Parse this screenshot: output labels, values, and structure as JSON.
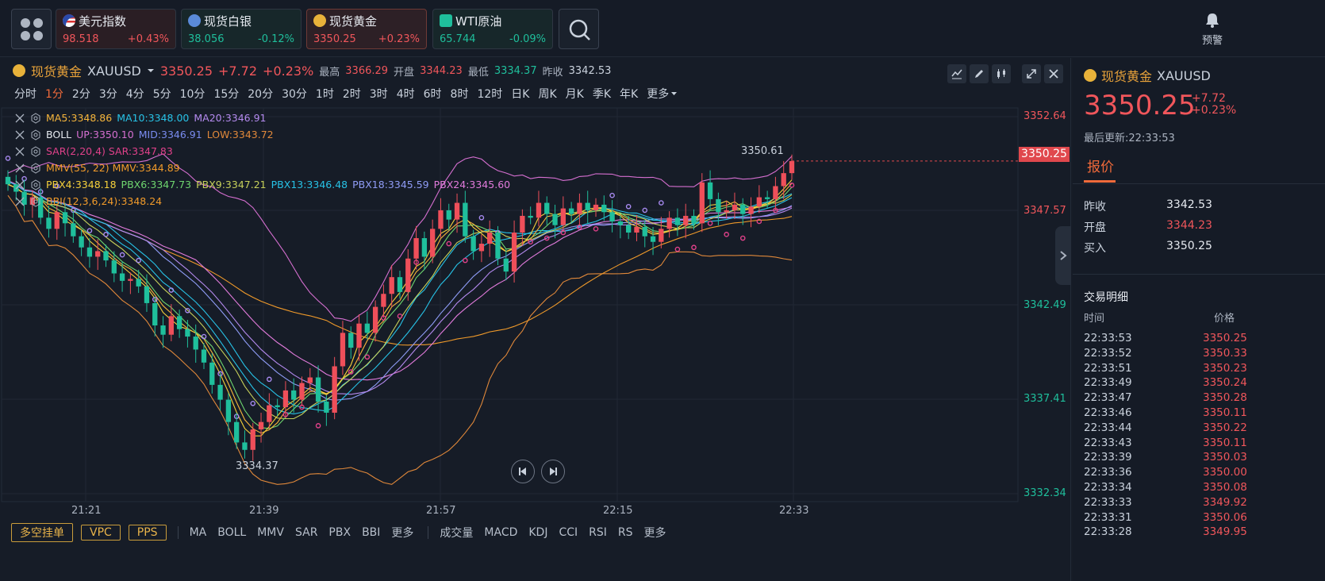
{
  "topbar": {
    "tickers": [
      {
        "name": "美元指数",
        "price": "98.518",
        "change": "+0.43%",
        "trend": "up",
        "icon": "us-flag-icon"
      },
      {
        "name": "现货白银",
        "price": "38.056",
        "change": "-0.12%",
        "trend": "down",
        "icon": "silver-icon"
      },
      {
        "name": "现货黄金",
        "price": "3350.25",
        "change": "+0.23%",
        "trend": "up",
        "icon": "gold-icon"
      },
      {
        "name": "WTI原油",
        "price": "65.744",
        "change": "-0.09%",
        "trend": "down",
        "icon": "oil-icon"
      }
    ],
    "alarm_label": "预警"
  },
  "chart_header": {
    "name": "现货黄金",
    "symbol": "XAUUSD",
    "price": "3350.25",
    "change": "+7.72",
    "change_pct": "+0.23%",
    "high_label": "最高",
    "high": "3366.29",
    "open_label": "开盘",
    "open": "3344.23",
    "low_label": "最低",
    "low": "3334.37",
    "prev_label": "昨收",
    "prev": "3342.53"
  },
  "periods": [
    "分时",
    "1分",
    "2分",
    "3分",
    "4分",
    "5分",
    "10分",
    "15分",
    "20分",
    "30分",
    "1时",
    "2时",
    "3时",
    "4时",
    "6时",
    "8时",
    "12时",
    "日K",
    "周K",
    "月K",
    "季K",
    "年K",
    "更多"
  ],
  "active_period": "1分",
  "indicators": [
    {
      "items": [
        {
          "text": "MA5:3348.86",
          "color": "#f6b53b"
        },
        {
          "text": "MA10:3348.00",
          "color": "#27c2e6"
        },
        {
          "text": "MA20:3346.91",
          "color": "#b48aef"
        }
      ]
    },
    {
      "items": [
        {
          "text": "BOLL",
          "color": "#e6eaf0"
        },
        {
          "text": "UP:3350.10",
          "color": "#d56fd0"
        },
        {
          "text": "MID:3346.91",
          "color": "#7a8cf0"
        },
        {
          "text": "LOW:3343.72",
          "color": "#e0883a"
        }
      ]
    },
    {
      "items": [
        {
          "text": "SAR(2,20,4) SAR:3347.83",
          "color": "#e0418a"
        }
      ]
    },
    {
      "items": [
        {
          "text": "MMV(55, 22) MMV:3344.89",
          "color": "#f09a2a"
        }
      ]
    },
    {
      "items": [
        {
          "text": "PBX4:3348.18",
          "color": "#f6d13b"
        },
        {
          "text": "PBX6:3347.73",
          "color": "#6fd66f"
        },
        {
          "text": "PBX9:3347.21",
          "color": "#c6d05a"
        },
        {
          "text": "PBX13:3346.48",
          "color": "#27c2e6"
        },
        {
          "text": "PBX18:3345.59",
          "color": "#8f9cf6"
        },
        {
          "text": "PBX24:3345.60",
          "color": "#e27bdc"
        }
      ]
    },
    {
      "items": [
        {
          "text": "BBI(12,3,6,24):3348.24",
          "color": "#f09a2a"
        }
      ]
    }
  ],
  "chart_data": {
    "type": "candlestick",
    "y_axis": {
      "ticks": [
        "3352.64",
        "3347.57",
        "3342.49",
        "3337.41",
        "3332.34"
      ],
      "min": 3332.34,
      "max": 3352.64
    },
    "x_axis": {
      "ticks": [
        "21:21",
        "21:39",
        "21:57",
        "22:15",
        "22:33"
      ]
    },
    "current_price": "3350.25",
    "annotations": {
      "high_mark": "3350.61",
      "low_mark": "3334.37"
    },
    "close": [
      3349.0,
      3348.6,
      3347.9,
      3348.3,
      3347.2,
      3346.6,
      3347.5,
      3346.9,
      3346.2,
      3345.6,
      3345.1,
      3345.4,
      3344.9,
      3344.2,
      3343.8,
      3343.9,
      3343.5,
      3342.6,
      3341.4,
      3340.9,
      3341.9,
      3341.2,
      3340.8,
      3340.1,
      3339.4,
      3338.2,
      3337.4,
      3336.2,
      3335.1,
      3334.7,
      3335.8,
      3336.2,
      3337.1,
      3337.0,
      3337.9,
      3337.4,
      3338.3,
      3338.6,
      3337.3,
      3336.7,
      3339.2,
      3341.0,
      3340.2,
      3341.5,
      3341.0,
      3342.4,
      3343.1,
      3344.0,
      3343.2,
      3345.0,
      3346.1,
      3345.1,
      3346.6,
      3347.6,
      3347.1,
      3348.0,
      3346.2,
      3345.4,
      3345.8,
      3346.4,
      3345.0,
      3344.3,
      3346.4,
      3347.3,
      3347.2,
      3348.0,
      3347.4,
      3346.8,
      3347.7,
      3347.4,
      3348.0,
      3347.6,
      3347.9,
      3347.5,
      3347.0,
      3346.8,
      3346.4,
      3346.7,
      3346.2,
      3345.9,
      3346.6,
      3347.2,
      3346.8,
      3347.3,
      3346.9,
      3349.1,
      3348.2,
      3347.5,
      3347.6,
      3347.9,
      3347.4,
      3347.8,
      3348.3,
      3348.2,
      3348.9,
      3349.6,
      3350.25
    ]
  },
  "bottombar": {
    "buttons": [
      "多空挂单",
      "VPC",
      "PPS"
    ],
    "main_indicators": [
      "MA",
      "BOLL",
      "MMV",
      "SAR",
      "PBX",
      "BBI",
      "更多"
    ],
    "sub_indicators": [
      "成交量",
      "MACD",
      "KDJ",
      "CCI",
      "RSI",
      "RS",
      "更多"
    ]
  },
  "right_panel": {
    "name": "现货黄金",
    "symbol": "XAUUSD",
    "price": "3350.25",
    "change": "+7.72",
    "change_pct": "+0.23%",
    "updated": "最后更新:22:33:53",
    "tab": "报价",
    "quotes": [
      {
        "label": "昨收",
        "value": "3342.53",
        "trend": "neutral"
      },
      {
        "label": "开盘",
        "value": "3344.23",
        "trend": "up"
      },
      {
        "label": "买入",
        "value": "3350.25",
        "trend": "neutral"
      }
    ],
    "trades_title": "交易明细",
    "col_time": "时间",
    "col_price": "价格",
    "trades": [
      {
        "time": "22:33:53",
        "price": "3350.25"
      },
      {
        "time": "22:33:52",
        "price": "3350.33"
      },
      {
        "time": "22:33:51",
        "price": "3350.23"
      },
      {
        "time": "22:33:49",
        "price": "3350.24"
      },
      {
        "time": "22:33:47",
        "price": "3350.28"
      },
      {
        "time": "22:33:46",
        "price": "3350.11"
      },
      {
        "time": "22:33:44",
        "price": "3350.22"
      },
      {
        "time": "22:33:43",
        "price": "3350.11"
      },
      {
        "time": "22:33:39",
        "price": "3350.03"
      },
      {
        "time": "22:33:36",
        "price": "3350.00"
      },
      {
        "time": "22:33:34",
        "price": "3350.08"
      },
      {
        "time": "22:33:33",
        "price": "3349.92"
      },
      {
        "time": "22:33:31",
        "price": "3350.06"
      },
      {
        "time": "22:33:28",
        "price": "3349.95"
      }
    ]
  }
}
